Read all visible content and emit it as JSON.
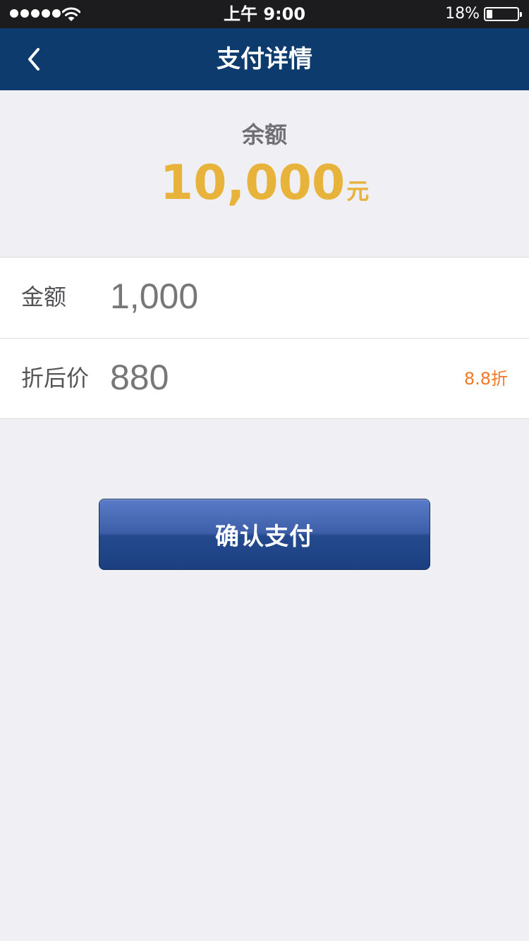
{
  "status_bar": {
    "time": "上午 9:00",
    "battery_percent_text": "18%",
    "battery_level": 0.18,
    "signal_dots": 5,
    "icons": [
      "signal-dots",
      "wifi-icon",
      "battery-icon"
    ]
  },
  "nav": {
    "back_icon": "chevron-left-icon",
    "title": "支付详情"
  },
  "balance": {
    "label": "余额",
    "amount": "10,000",
    "unit": "元"
  },
  "form": {
    "rows": [
      {
        "label": "金额",
        "value": "1,000",
        "badge": ""
      },
      {
        "label": "折后价",
        "value": "880",
        "badge": "8.8折"
      }
    ]
  },
  "actions": {
    "confirm_label": "确认支付"
  },
  "colors": {
    "nav_background": "#0e3b6e",
    "status_background": "#1c1c1e",
    "page_background": "#efeff4",
    "balance_accent": "#e8b33a",
    "discount_accent": "#f07a2a",
    "button_blue": "#2b4f96"
  }
}
